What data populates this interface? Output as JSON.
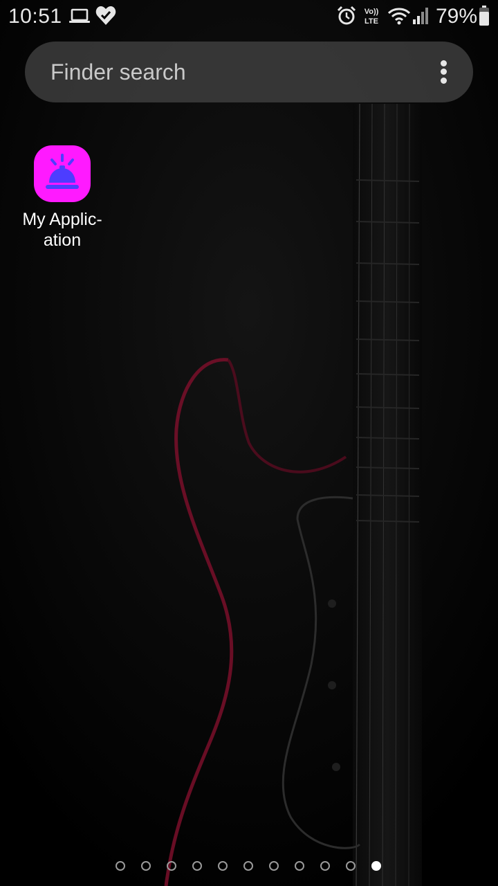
{
  "status_bar": {
    "time": "10:51",
    "battery": "79%",
    "icons": [
      "laptop-icon",
      "heart-check-icon",
      "alarm-icon",
      "volte-icon",
      "wifi-icon",
      "signal-icon",
      "battery-icon"
    ],
    "volte_top": "Vo))",
    "volte_bottom": "LTE"
  },
  "search": {
    "placeholder": "Finder search",
    "menu_icon": "more-vertical-icon"
  },
  "apps": [
    {
      "label": "My Applic-\nation",
      "icon": "service-bell-icon",
      "tile_color": "#ff1aff",
      "glyph_color": "#4d3dff"
    }
  ],
  "pager": {
    "total": 11,
    "active_index": 10
  },
  "wallpaper": {
    "subject": "guitar-silhouette",
    "accent": "#7a0f2a"
  }
}
